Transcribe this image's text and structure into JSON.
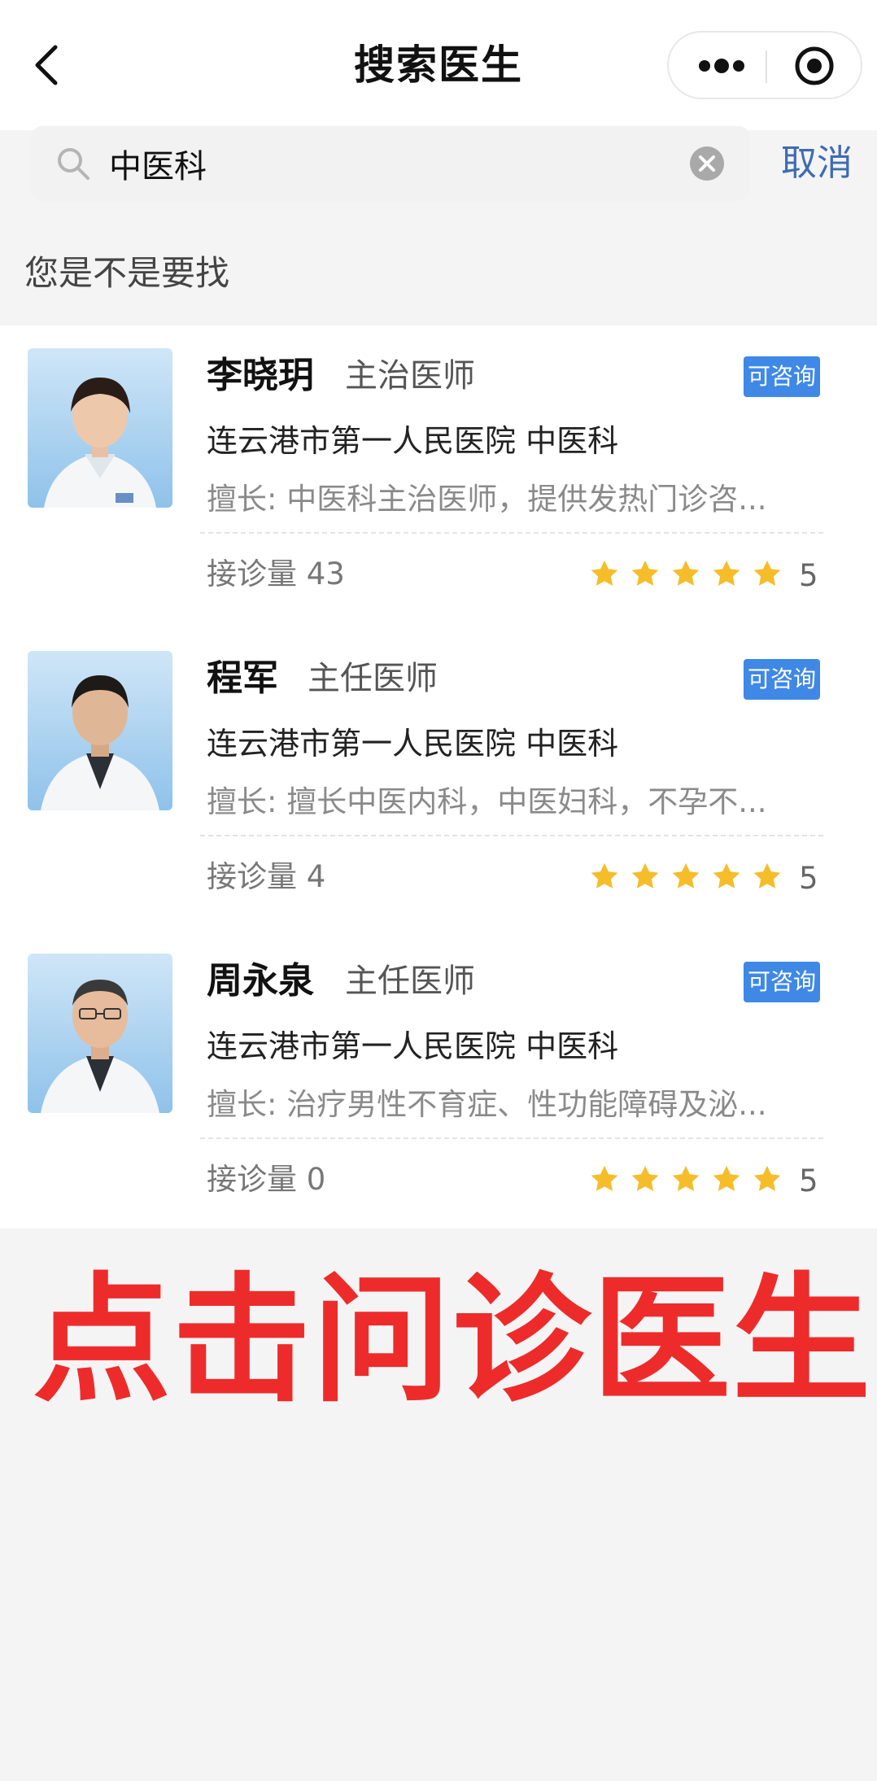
{
  "header": {
    "title": "搜索医生",
    "back_icon": "chevron-left-icon",
    "more_icon": "more-dots-icon",
    "close_icon": "target-close-icon"
  },
  "search": {
    "value": "中医科",
    "placeholder": "",
    "cancel_label": "取消"
  },
  "suggest_label": "您是不是要找",
  "doctors": [
    {
      "name": "李晓玥",
      "title": "主治医师",
      "badge": "可咨询",
      "hospital": "连云港市第一人民医院  中医科",
      "specialty": "擅长: 中医科主治医师，提供发热门诊咨...",
      "consults": "接诊量 43",
      "stars": 5,
      "rating": "5"
    },
    {
      "name": "程军",
      "title": "主任医师",
      "badge": "可咨询",
      "hospital": "连云港市第一人民医院  中医科",
      "specialty": "擅长: 擅长中医内科，中医妇科，不孕不...",
      "consults": "接诊量 4",
      "stars": 5,
      "rating": "5"
    },
    {
      "name": "周永泉",
      "title": "主任医师",
      "badge": "可咨询",
      "hospital": "连云港市第一人民医院  中医科",
      "specialty": "擅长: 治疗男性不育症、性功能障碍及泌...",
      "consults": "接诊量 0",
      "stars": 5,
      "rating": "5"
    }
  ],
  "cta": "点击问诊医生",
  "colors": {
    "accent_blue": "#3f88e6",
    "link_blue": "#3f6bb4",
    "star_gold": "#f6bd2b",
    "cta_red": "#ee2b2b"
  }
}
